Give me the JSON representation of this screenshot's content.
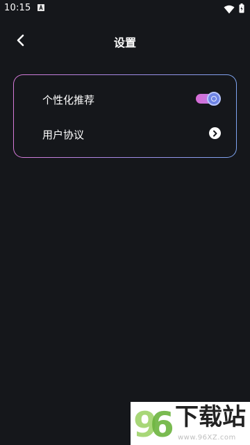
{
  "status_bar": {
    "time": "10:15",
    "app_icon": "a-notification-icon",
    "wifi_icon": "wifi-icon",
    "battery_icon": "battery-icon"
  },
  "header": {
    "back_icon": "chevron-left-icon",
    "title": "设置"
  },
  "settings": {
    "items": [
      {
        "label": "个性化推荐",
        "control": "toggle",
        "enabled": true
      },
      {
        "label": "用户协议",
        "control": "chevron-right-icon"
      }
    ]
  },
  "watermark": {
    "logo_text": "96",
    "text": "下载站",
    "url": "www.96XZ.com"
  },
  "colors": {
    "background": "#15171b",
    "card_border_start": "#d77ad9",
    "card_border_end": "#7fa6f2",
    "toggle_track": "#d86bd6",
    "toggle_knob": "#6f85e6"
  }
}
